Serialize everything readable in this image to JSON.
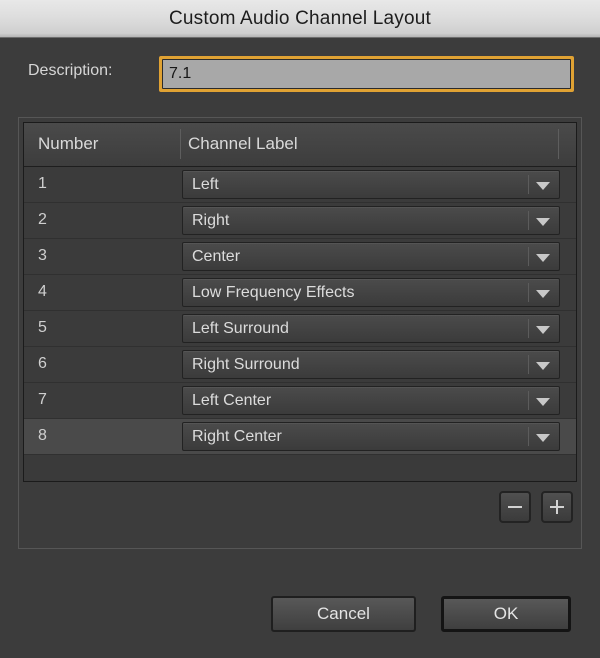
{
  "window": {
    "title": "Custom Audio Channel Layout"
  },
  "description": {
    "label": "Description:",
    "value": "7.1",
    "placeholder": ""
  },
  "table": {
    "columns": [
      "Number",
      "Channel Label"
    ],
    "rows": [
      {
        "number": "1",
        "label": "Left",
        "selected": false
      },
      {
        "number": "2",
        "label": "Right",
        "selected": false
      },
      {
        "number": "3",
        "label": "Center",
        "selected": false
      },
      {
        "number": "4",
        "label": "Low Frequency Effects",
        "selected": false
      },
      {
        "number": "5",
        "label": "Left Surround",
        "selected": false
      },
      {
        "number": "6",
        "label": "Right Surround",
        "selected": false
      },
      {
        "number": "7",
        "label": "Left Center",
        "selected": false
      },
      {
        "number": "8",
        "label": "Right Center",
        "selected": true
      }
    ]
  },
  "list_controls": {
    "remove_label": "–",
    "add_label": "+",
    "remove_icon": "minus-icon",
    "add_icon": "plus-icon"
  },
  "footer": {
    "cancel_label": "Cancel",
    "ok_label": "OK"
  },
  "colors": {
    "dialog_background": "#3c3c3c",
    "titlebar_top": "#e8e8e8",
    "titlebar_bottom": "#b4b4b4",
    "focus_ring": "#e0a233",
    "text_primary": "#dcdcdc",
    "field_background": "#a8a8a8",
    "row_selected": "#4a4a4a"
  }
}
